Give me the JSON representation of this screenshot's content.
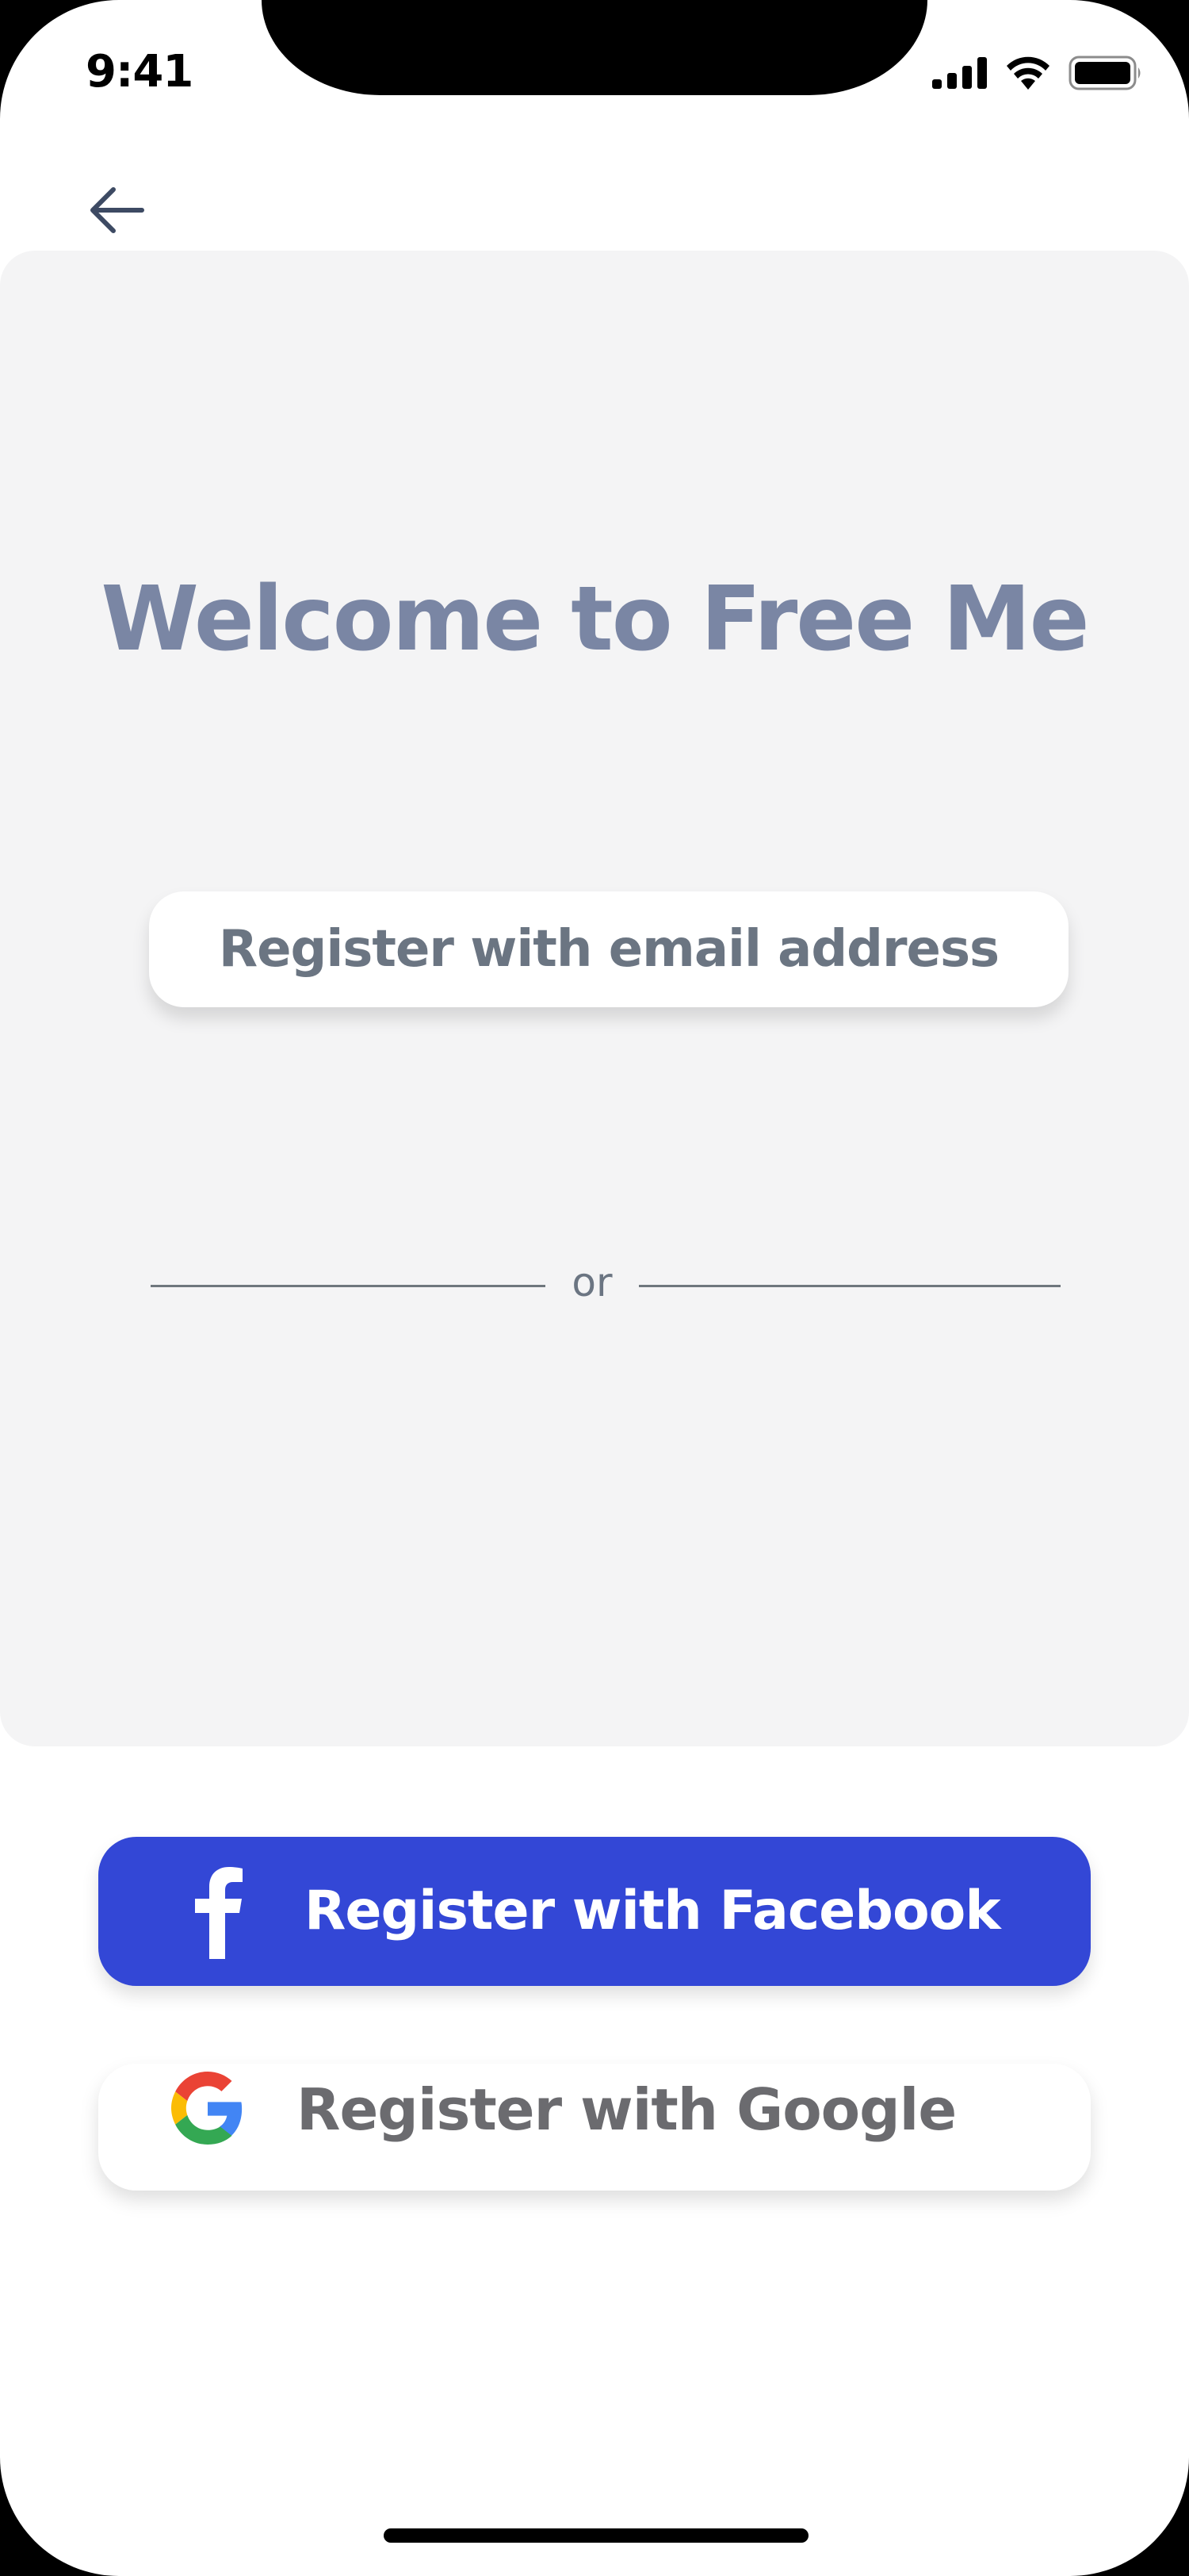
{
  "status_bar": {
    "time": "9:41",
    "icons": [
      "cellular-signal-icon",
      "wifi-icon",
      "battery-icon"
    ]
  },
  "nav": {
    "back_icon": "arrow-left-icon"
  },
  "welcome": {
    "title": "Welcome to Free Me"
  },
  "email_register": {
    "label": "Register with email address"
  },
  "divider": {
    "text": "or"
  },
  "facebook_register": {
    "label": "Register with Facebook",
    "icon": "facebook-icon",
    "color": "#3347d6"
  },
  "google_register": {
    "label": "Register with Google",
    "icon": "google-icon"
  },
  "colors": {
    "card_background": "#f4f4f5",
    "title_text": "#7a86a4",
    "secondary_text": "#6b7582"
  }
}
